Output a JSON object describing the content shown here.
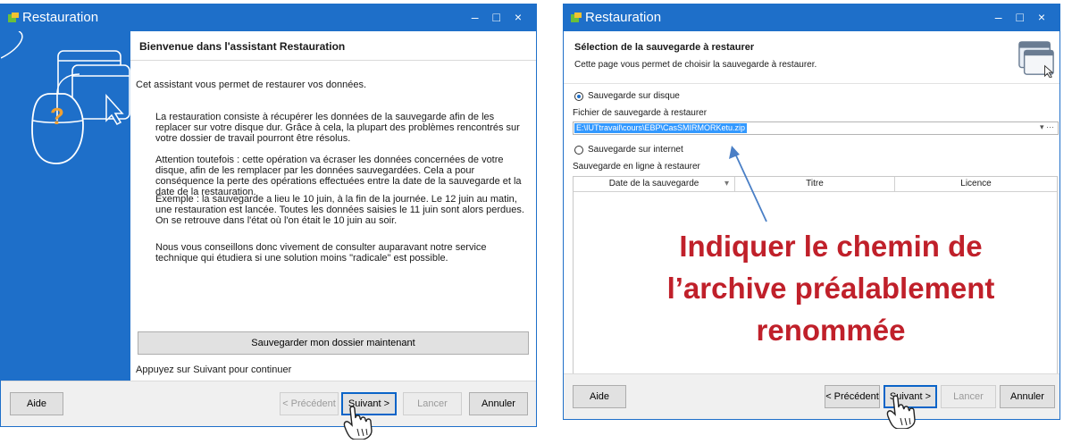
{
  "left_window": {
    "title": "Restauration",
    "controls": "– □ ×",
    "heading": "Bienvenue dans l'assistant Restauration",
    "intro": "Cet assistant vous permet de restaurer vos données.",
    "p1": "La restauration consiste à récupérer les données de la sauvegarde afin de les replacer sur votre disque dur. Grâce à cela, la plupart des problèmes rencontrés sur votre dossier de travail pourront être résolus.",
    "p2": "Attention toutefois : cette opération va écraser les données concernées de votre disque, afin de les remplacer par les données sauvegardées. Cela a pour conséquence la perte des opérations effectuées entre la date de la sauvegarde et la date de la restauration.",
    "p3": "Exemple : la sauvegarde a lieu le 10 juin, à la fin de la journée. Le 12 juin au matin, une restauration est lancée. Toutes les données saisies le 11 juin sont alors perdues. On se retrouve dans l'état où l'on était le 10 juin au soir.",
    "p4": "Nous vous conseillons donc vivement de consulter auparavant notre service technique qui étudiera si une solution moins \"radicale\" est possible.",
    "save_now_button": "Sauvegarder mon dossier maintenant",
    "continue_hint": "Appuyez sur Suivant pour continuer",
    "buttons": {
      "help": "Aide",
      "previous": "< Précédent",
      "next": "Suivant >",
      "launch": "Lancer",
      "cancel": "Annuler"
    }
  },
  "right_window": {
    "title": "Restauration",
    "controls": "– □ ×",
    "heading": "Sélection de la sauvegarde à restaurer",
    "subheading": "Cette page vous permet de choisir la sauvegarde à restaurer.",
    "radio_disk": "Sauvegarde sur disque",
    "file_label": "Fichier de sauvegarde à restaurer",
    "file_value": "E:\\IUTtravail\\cours\\EBP\\CasSMIRMORKetu.zip",
    "dropdown_glyphs": "▾ ···",
    "radio_internet": "Sauvegarde sur internet",
    "online_label": "Sauvegarde en ligne à restaurer",
    "table_headers": [
      "Date de la sauvegarde",
      "Titre",
      "Licence"
    ],
    "buttons": {
      "help": "Aide",
      "previous": "< Précédent",
      "next": "Suivant >",
      "launch": "Lancer",
      "cancel": "Annuler"
    }
  },
  "annotation": {
    "lines": [
      "Indiquer le chemin de",
      "l’archive préalablement",
      "renommée"
    ],
    "color": "#c0202a",
    "arrow_color": "#4a7fc6"
  },
  "colors": {
    "title_bar": "#1e6fc9",
    "selection": "#3399ff"
  },
  "icons": [
    "app-icon",
    "wizard-mouse-illustration",
    "wizard-window-icon",
    "hand-cursor-icon"
  ]
}
